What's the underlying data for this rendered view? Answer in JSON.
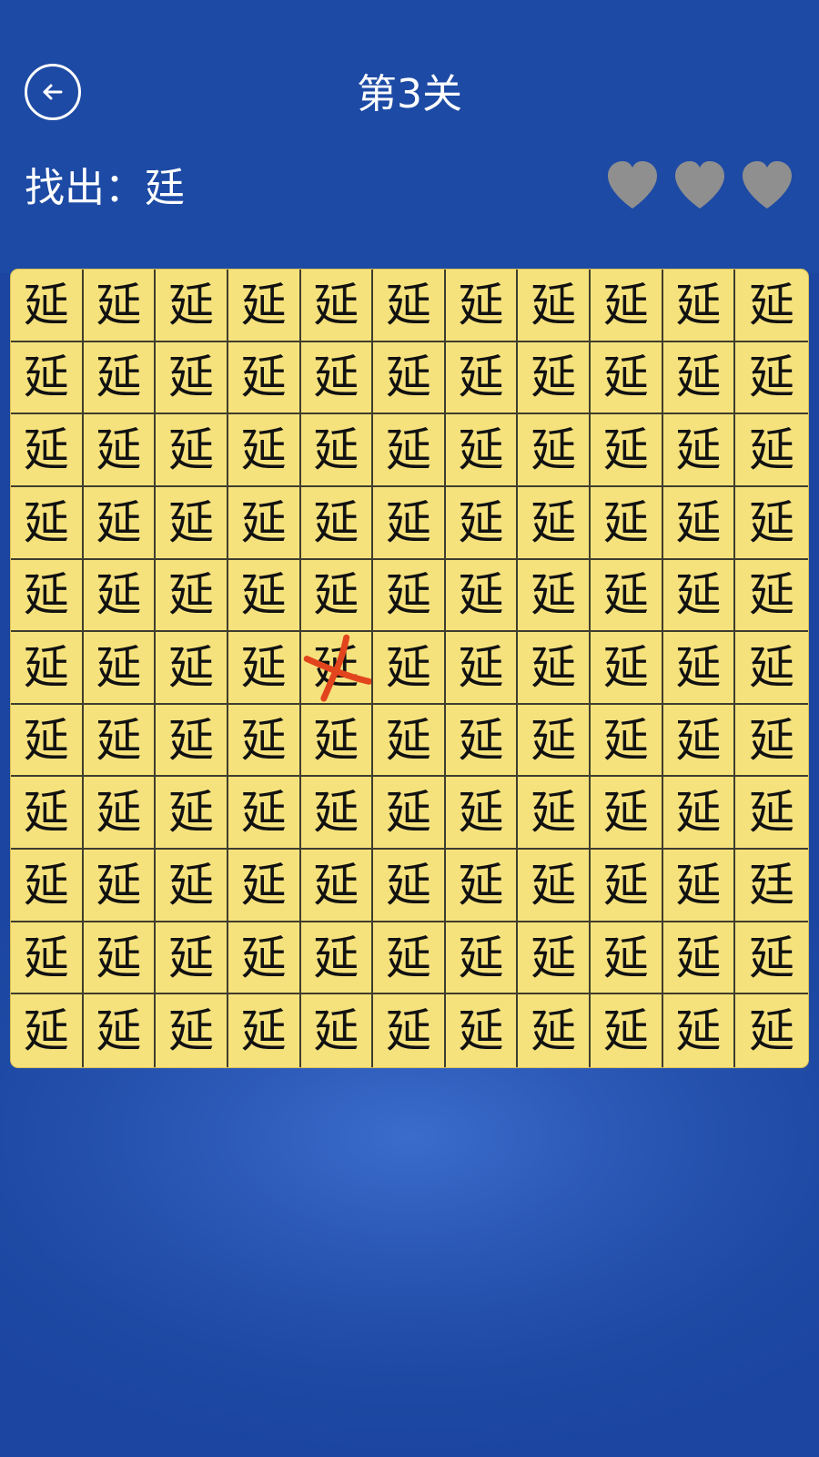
{
  "header": {
    "level_title": "第3关",
    "back_icon": "back-arrow-icon"
  },
  "task": {
    "find_label": "找出：廷"
  },
  "lives": {
    "total": 3,
    "remaining": 0,
    "heart_color": "#8f8f8f",
    "icon": "heart-icon"
  },
  "grid": {
    "rows": 11,
    "cols": 11,
    "common_char": "延",
    "target_char": "廷",
    "target_position": {
      "row": 9,
      "col": 11
    },
    "wrong_mark_position": {
      "row": 6,
      "col": 5
    },
    "wrong_mark_color": "#e2451d"
  }
}
